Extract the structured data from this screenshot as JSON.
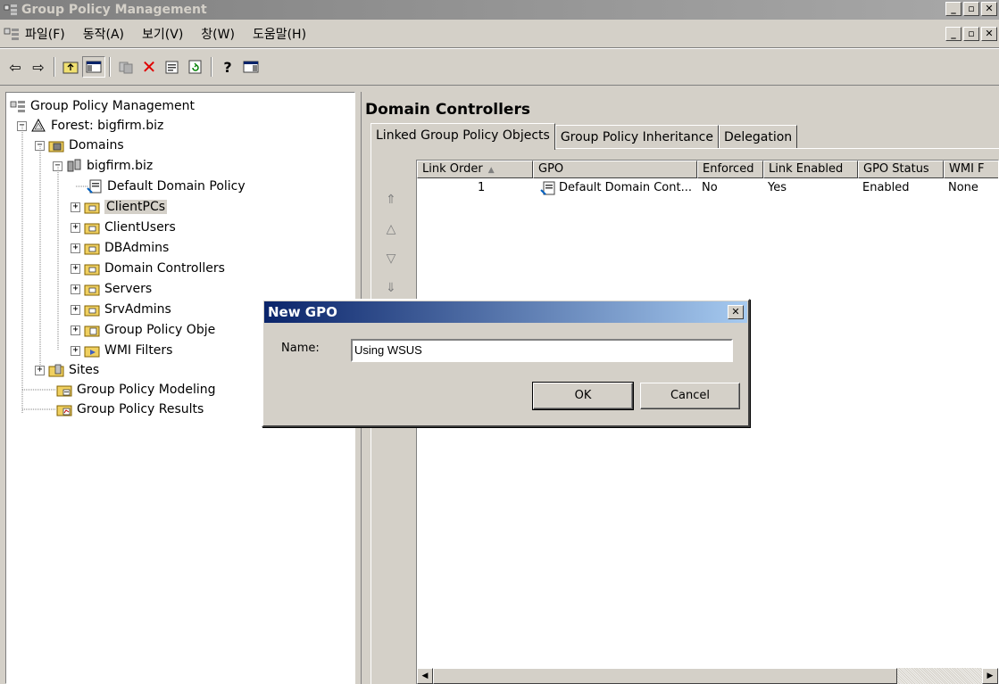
{
  "window": {
    "title": "Group Policy Management"
  },
  "menu": {
    "items": [
      "파일(F)",
      "동작(A)",
      "보기(V)",
      "창(W)",
      "도움말(H)"
    ]
  },
  "tree": {
    "root": "Group Policy Management",
    "forest": "Forest: bigfirm.biz",
    "domains": "Domains",
    "domain": "bigfirm.biz",
    "default_policy": "Default Domain Policy",
    "ous": [
      "ClientPCs",
      "ClientUsers",
      "DBAdmins",
      "Domain Controllers",
      "Servers",
      "SrvAdmins"
    ],
    "gpo_container": "Group Policy Obje",
    "wmi": "WMI Filters",
    "sites": "Sites",
    "modeling": "Group Policy Modeling",
    "results": "Group Policy Results",
    "selected": "ClientPCs"
  },
  "right": {
    "title": "Domain Controllers",
    "tabs": [
      "Linked Group Policy Objects",
      "Group Policy Inheritance",
      "Delegation"
    ],
    "active_tab": 0,
    "columns": [
      "Link Order",
      "GPO",
      "Enforced",
      "Link Enabled",
      "GPO Status",
      "WMI F"
    ],
    "rows": [
      {
        "link_order": "1",
        "gpo": "Default Domain Cont...",
        "enforced": "No",
        "link_enabled": "Yes",
        "gpo_status": "Enabled",
        "wmi": "None"
      }
    ]
  },
  "dialog": {
    "title": "New GPO",
    "name_label": "Name:",
    "name_value": "Using WSUS",
    "ok": "OK",
    "cancel": "Cancel"
  },
  "colors": {
    "dialog_title_start": "#0a246a",
    "dialog_title_end": "#a6caf0",
    "inactive_title": "#808080",
    "face": "#d4d0c8"
  }
}
